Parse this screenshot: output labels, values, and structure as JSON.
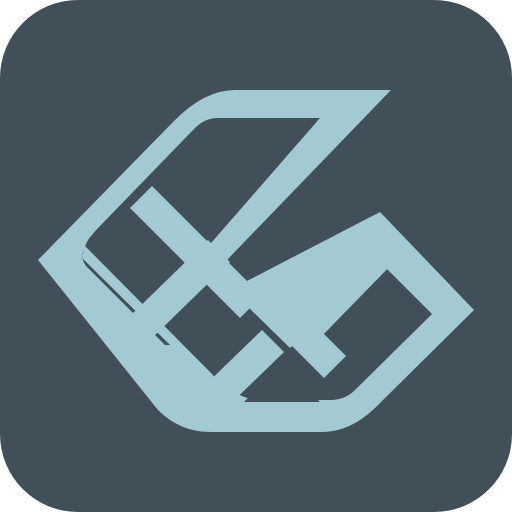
{
  "icon": {
    "name": "app-logo-icon",
    "tile_color": "#404F58",
    "mark_color": "#A3CAD2",
    "corner_background": "#FFFFFF"
  }
}
